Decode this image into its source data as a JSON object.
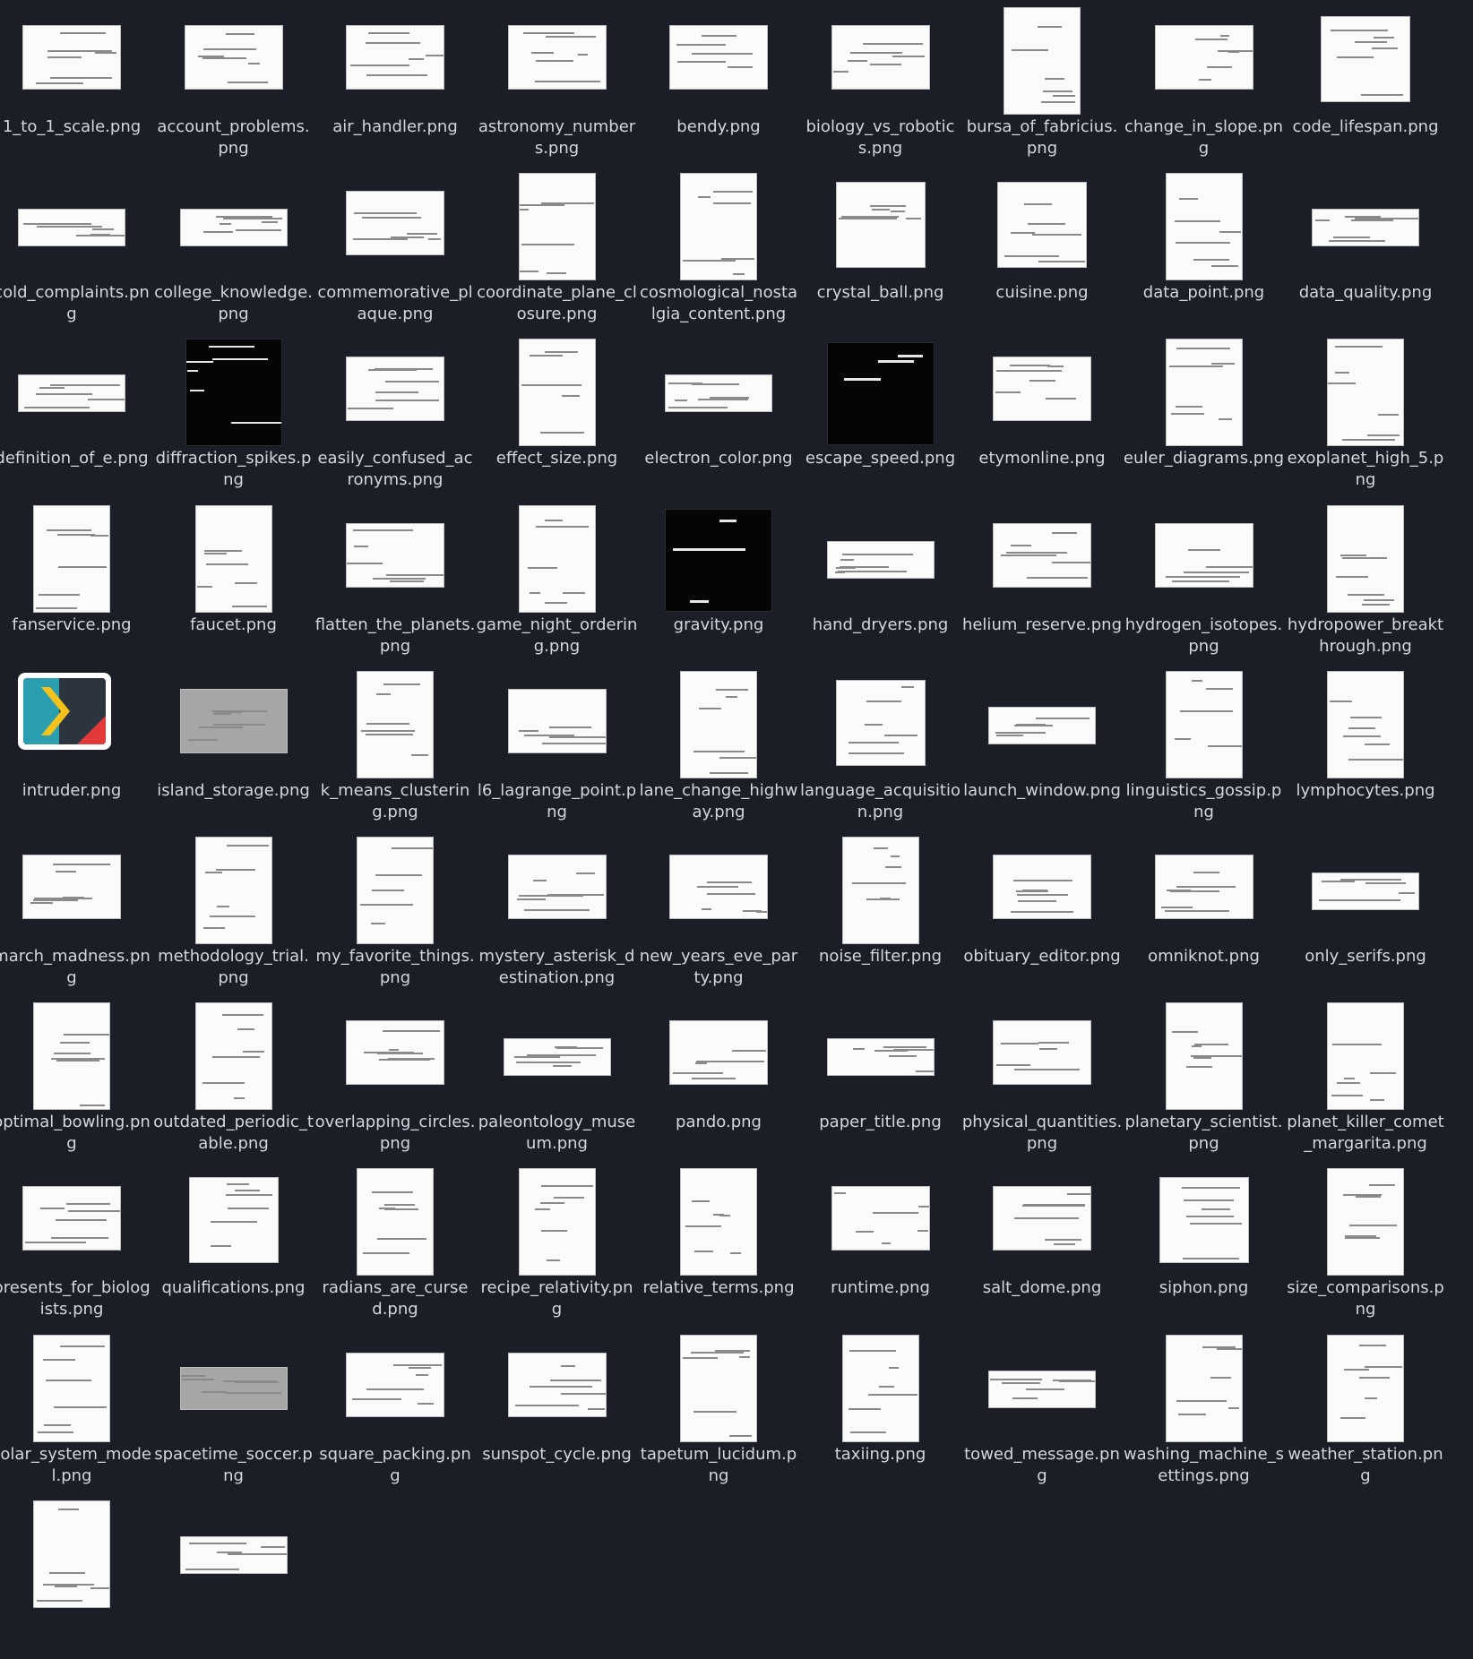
{
  "files": [
    "1_to_1_scale.png",
    "account_problems.png",
    "air_handler.png",
    "astronomy_numbers.png",
    "bendy.png",
    "biology_vs_robotics.png",
    "bursa_of_fabricius.png",
    "change_in_slope.png",
    "code_lifespan.png",
    "cold_complaints.png",
    "college_knowledge.png",
    "commemorative_plaque.png",
    "coordinate_plane_closure.png",
    "cosmological_nostalgia_content.png",
    "crystal_ball.png",
    "cuisine.png",
    "data_point.png",
    "data_quality.png",
    "definition_of_e.png",
    "diffraction_spikes.png",
    "easily_confused_acronyms.png",
    "effect_size.png",
    "electron_color.png",
    "escape_speed.png",
    "etymonline.png",
    "euler_diagrams.png",
    "exoplanet_high_5.png",
    "fanservice.png",
    "faucet.png",
    "flatten_the_planets.png",
    "game_night_ordering.png",
    "gravity.png",
    "hand_dryers.png",
    "helium_reserve.png",
    "hydrogen_isotopes.png",
    "hydropower_breakthrough.png",
    "intruder.png",
    "island_storage.png",
    "k_means_clustering.png",
    "l6_lagrange_point.png",
    "lane_change_highway.png",
    "language_acquisition.png",
    "launch_window.png",
    "linguistics_gossip.png",
    "lymphocytes.png",
    "march_madness.png",
    "methodology_trial.png",
    "my_favorite_things.png",
    "mystery_asterisk_destination.png",
    "new_years_eve_party.png",
    "noise_filter.png",
    "obituary_editor.png",
    "omniknot.png",
    "only_serifs.png",
    "optimal_bowling.png",
    "outdated_periodic_table.png",
    "overlapping_circles.png",
    "paleontology_museum.png",
    "pando.png",
    "paper_title.png",
    "physical_quantities.png",
    "planetary_scientist.png",
    "planet_killer_comet_margarita.png",
    "presents_for_biologists.png",
    "qualifications.png",
    "radians_are_cursed.png",
    "recipe_relativity.png",
    "relative_terms.png",
    "runtime.png",
    "salt_dome.png",
    "siphon.png",
    "size_comparisons.png",
    "solar_system_model.png",
    "spacetime_soccer.png",
    "square_packing.png",
    "sunspot_cycle.png",
    "tapetum_lucidum.png",
    "taxiing.png",
    "towed_message.png",
    "washing_machine_settings.png",
    "weather_station.png",
    "",
    ""
  ],
  "thumbs": [
    "wide",
    "wide",
    "wide",
    "wide",
    "wide",
    "wide",
    "tall",
    "wide",
    "sq",
    "strip",
    "strip",
    "wide",
    "tall",
    "tall",
    "sq",
    "sq",
    "tall",
    "strip",
    "strip",
    "tall-dark",
    "wide",
    "tall",
    "strip",
    "dark",
    "wide",
    "tall",
    "tall",
    "tall",
    "tall",
    "wide",
    "tall",
    "dark",
    "strip",
    "wide",
    "wide",
    "tall",
    "app",
    "grey",
    "tall",
    "wide",
    "tall",
    "sq",
    "strip",
    "tall",
    "tall",
    "wide",
    "tall",
    "tall",
    "wide",
    "wide",
    "tall",
    "wide",
    "wide",
    "strip",
    "tall",
    "tall",
    "wide",
    "strip",
    "wide",
    "strip",
    "wide",
    "tall",
    "tall",
    "wide",
    "sq",
    "tall",
    "tall",
    "tall",
    "wide",
    "wide",
    "sq",
    "tall",
    "tall",
    "grey-strip",
    "wide",
    "wide",
    "tall",
    "tall",
    "strip",
    "tall",
    "tall",
    "tall",
    "strip"
  ],
  "colors": {
    "background": "#1b1e27",
    "label": "#d4d6de"
  },
  "icons": {
    "app": "intruder-app-icon"
  }
}
